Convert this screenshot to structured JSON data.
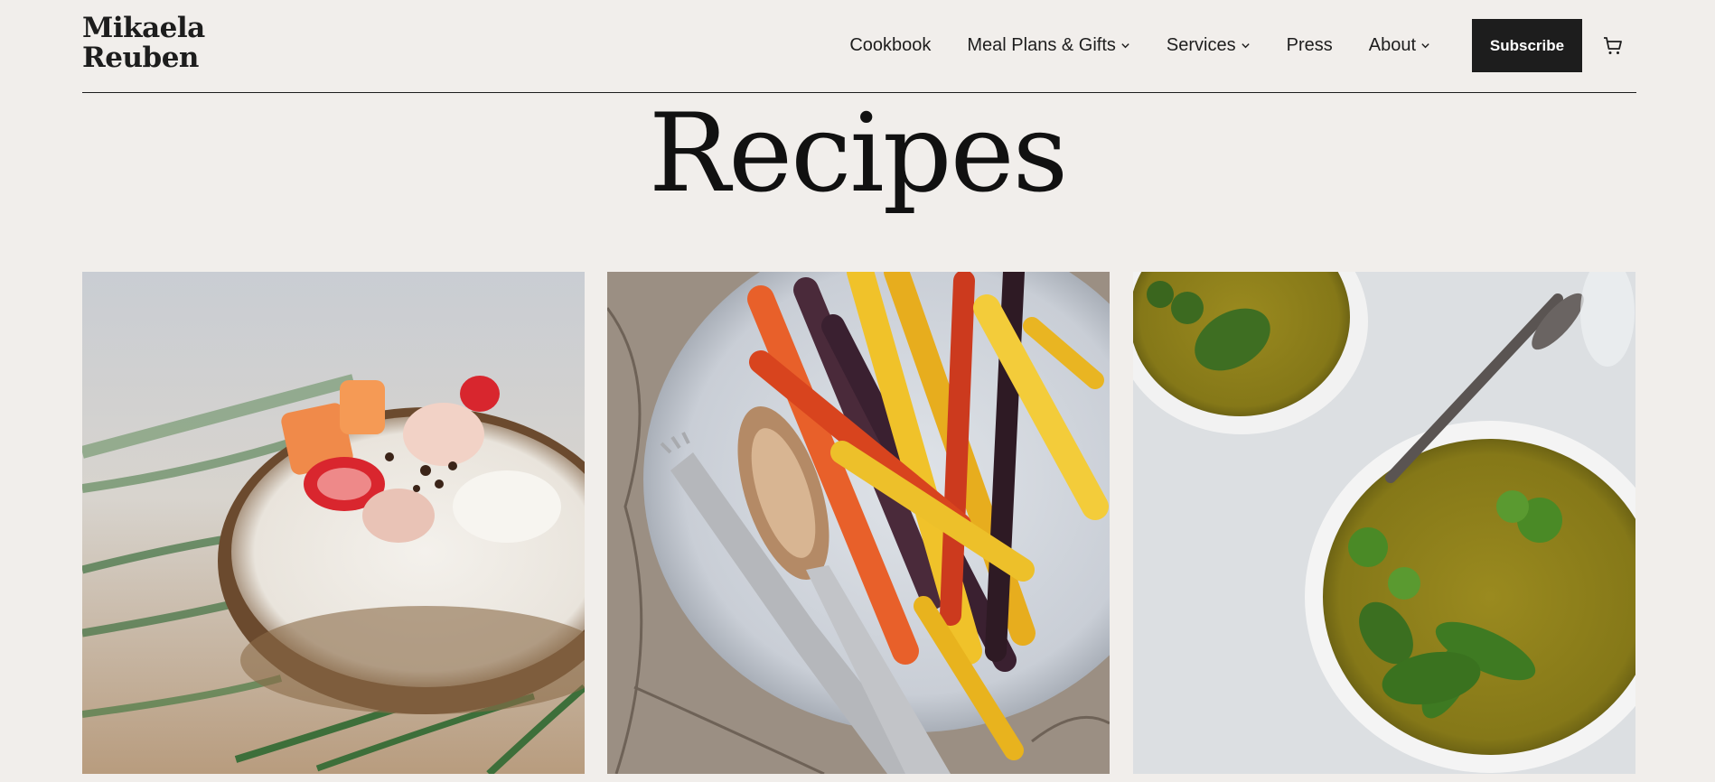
{
  "site": {
    "logo_line1": "Mikaela",
    "logo_line2": "Reuben"
  },
  "nav": {
    "items": [
      {
        "label": "Cookbook",
        "dropdown": false
      },
      {
        "label": "Meal Plans & Gifts",
        "dropdown": true
      },
      {
        "label": "Services",
        "dropdown": true
      },
      {
        "label": "Press",
        "dropdown": false
      },
      {
        "label": "About",
        "dropdown": true
      }
    ],
    "subscribe_label": "Subscribe",
    "cart_icon": "shopping-cart-icon"
  },
  "page": {
    "title": "Recipes"
  },
  "recipes": [
    {
      "image": "coconut bowl with strawberries, papaya and shredded coconut"
    },
    {
      "image": "roasted rainbow carrots on a plate with fork and spoon"
    },
    {
      "image": "green broccoli soup in bowls with spinach leaves"
    }
  ],
  "colors": {
    "background": "#f1eeeb",
    "text": "#1d1d1d",
    "button_bg": "#1d1d1d",
    "button_text": "#ffffff"
  }
}
